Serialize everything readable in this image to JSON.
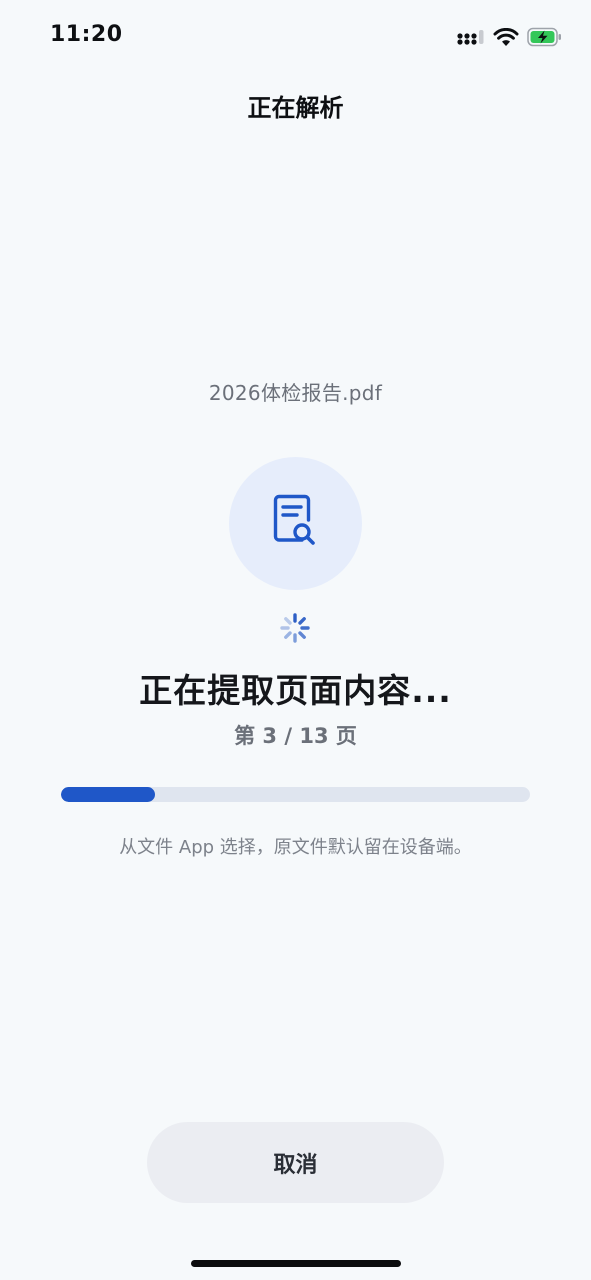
{
  "status_bar": {
    "time": "11:20",
    "icons": [
      "cellular-signal-icon",
      "wifi-icon",
      "battery-charging-icon"
    ]
  },
  "nav": {
    "title": "正在解析"
  },
  "file": {
    "name": "2026体检报告.pdf",
    "icon": "document-search-icon"
  },
  "progress": {
    "stage": "正在提取页面内容...",
    "page_label": "第 3 / 13 页",
    "current_page": 3,
    "total_pages": 13,
    "fraction": 0.2
  },
  "hint": "从文件 App 选择，原文件默认留在设备端。",
  "actions": {
    "cancel_label": "取消"
  },
  "colors": {
    "accent": "#1f57c8",
    "track": "#dfe5ef",
    "icon_bg": "#e6edfb",
    "battery_green": "#34c759"
  }
}
